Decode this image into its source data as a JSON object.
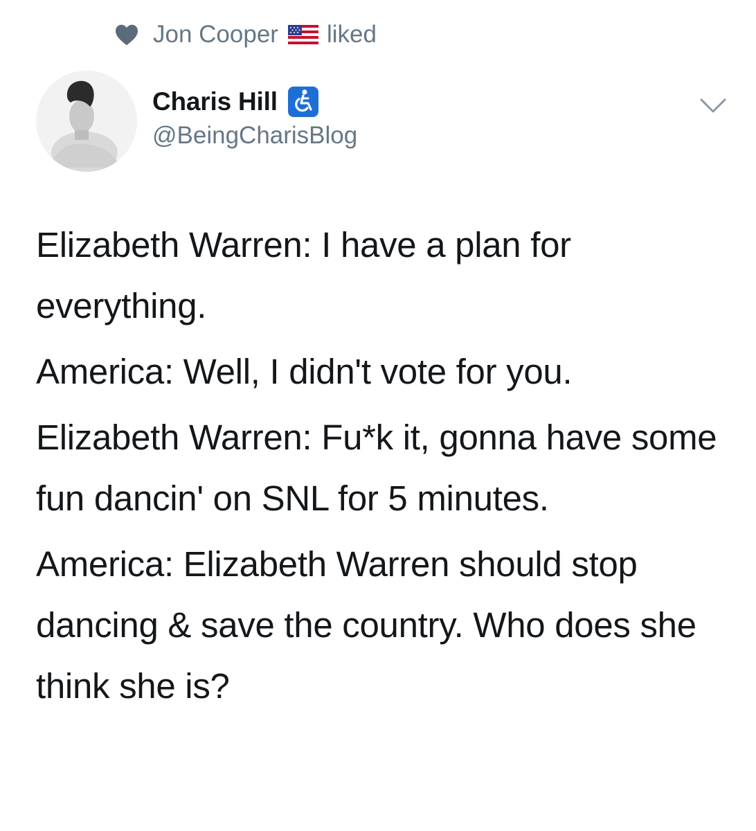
{
  "social_context": {
    "user_name": "Jon Cooper",
    "action": "liked",
    "heart_icon": "heart-icon",
    "flag_icon": "us-flag-icon",
    "color": "#657786"
  },
  "author": {
    "display_name": "Charis Hill",
    "handle": "@BeingCharisBlog",
    "badge_icon": "accessibility-wheelchair-icon",
    "badge_color": "#1d6fd6"
  },
  "tweet": {
    "paragraphs": [
      "Elizabeth Warren: I have a plan for everything.",
      "America: Well, I didn't vote for you.",
      "Elizabeth Warren: Fu*k it, gonna have some fun dancin' on SNL for 5 minutes.",
      "America: Elizabeth Warren should stop dancing & save the country. Who does she think she is?"
    ]
  },
  "menu": {
    "icon": "chevron-down-icon"
  }
}
